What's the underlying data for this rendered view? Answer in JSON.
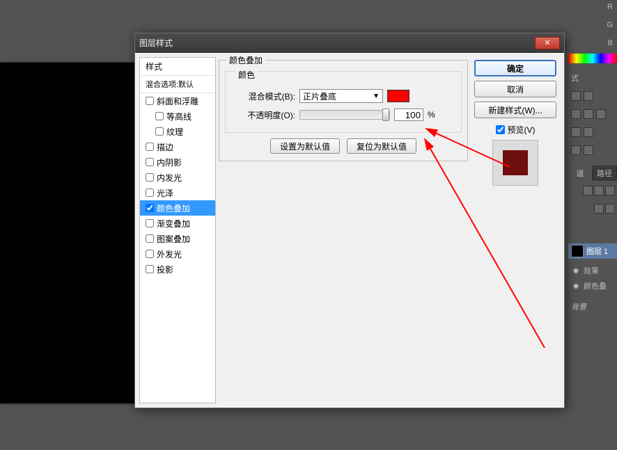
{
  "dialog": {
    "title": "图层样式",
    "styles_header": "样式",
    "blend_defaults": "混合选项:默认",
    "items": [
      {
        "label": "斜面和浮雕",
        "checked": false
      },
      {
        "label": "等高线",
        "checked": false,
        "indent": true
      },
      {
        "label": "纹理",
        "checked": false,
        "indent": true
      },
      {
        "label": "描边",
        "checked": false
      },
      {
        "label": "内阴影",
        "checked": false
      },
      {
        "label": "内发光",
        "checked": false
      },
      {
        "label": "光泽",
        "checked": false
      },
      {
        "label": "颜色叠加",
        "checked": true,
        "selected": true
      },
      {
        "label": "渐变叠加",
        "checked": false
      },
      {
        "label": "图案叠加",
        "checked": false
      },
      {
        "label": "外发光",
        "checked": false
      },
      {
        "label": "投影",
        "checked": false
      }
    ],
    "group": {
      "title": "颜色叠加",
      "inner_title": "颜色",
      "blend_mode_label": "混合模式(B):",
      "blend_mode_value": "正片叠底",
      "opacity_label": "不透明度(O):",
      "opacity_value": "100",
      "opacity_unit": "%",
      "color_swatch": "#ff0000",
      "set_default": "设置为默认值",
      "reset_default": "复位为默认值"
    },
    "buttons": {
      "ok": "确定",
      "cancel": "取消",
      "new_style": "新建样式(W)...",
      "preview": "预览(V)"
    },
    "preview_color": "#6e0e0e"
  },
  "right": {
    "channels": [
      "R",
      "G",
      "B"
    ],
    "style_tab": "式",
    "panel_tabs": [
      "道",
      "路径"
    ],
    "layer1": "图层 1",
    "effects": "效果",
    "color_overlay": "颜色叠",
    "background": "背景"
  }
}
